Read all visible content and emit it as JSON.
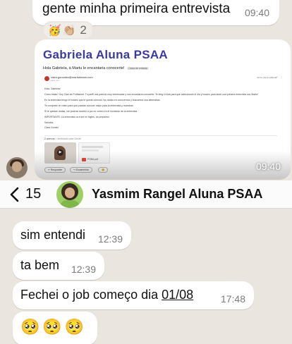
{
  "top_message": {
    "text": "gente minha primeira entrevista",
    "time": "09:40",
    "reactions": {
      "emojis": [
        "🥳",
        "👏🏼"
      ],
      "count": "2"
    }
  },
  "image_message": {
    "time": "09:40",
    "email": {
      "heading": "Gabriela Aluna PSAA",
      "subject": "Hola Gabriela, à Martu le encantaria conocerte!",
      "subject_tag": "Caixa de entrada",
      "sender": "clara.gonzalez@martubeans.com",
      "sender_sub": "para mim",
      "date": "09:03 (há 8 minutos)",
      "lines": [
        "Hola, Gabriela!",
        "Cómo estás? Soy Clari de ProMarket. Tu perfil nos pareció muy interesante y nos encantaría conocerte. Te elegí el link para que selecciones el día y horario para tener una primera entrevista con Martu!",
        "En la entrevista tengo el horario que te quede cómodo, los dudas en conocernos y buscamos una alternativa.",
        "Te comparto un video para que puedas conocer mejor para la entrevista y muestras",
        "Si te quedan dudas, me podrías escribir a por mí correo en el momento de la entrevista.",
        "IMPORTANTE: La entrevista va a ser en inglés, ¡to prepares!",
        "Saludos,",
        "Clara Gomez"
      ],
      "attachments_header": "2 anexos",
      "attachments_note": "• Verificado pelo Gmail",
      "attachment_file": "PSBA.pdf",
      "buttons": [
        "Responder",
        "Encaminhar",
        "😊"
      ]
    }
  },
  "header": {
    "back_count": "15",
    "contact_name": "Yasmim Rangel Aluna PSAA"
  },
  "messages": [
    {
      "text": "sim entendi",
      "time": "12:39"
    },
    {
      "text": "ta bem",
      "time": "12:39"
    },
    {
      "text_before": "Fechei o job começo dia ",
      "text_date": "01/08",
      "time": "17:48"
    },
    {
      "text": "🥺🥺🥺"
    }
  ],
  "colors": {
    "chat_background": "#eae6df",
    "bubble": "#ffffff",
    "email_heading": "#3a3aa0",
    "time_text": "#7b7b7b"
  }
}
